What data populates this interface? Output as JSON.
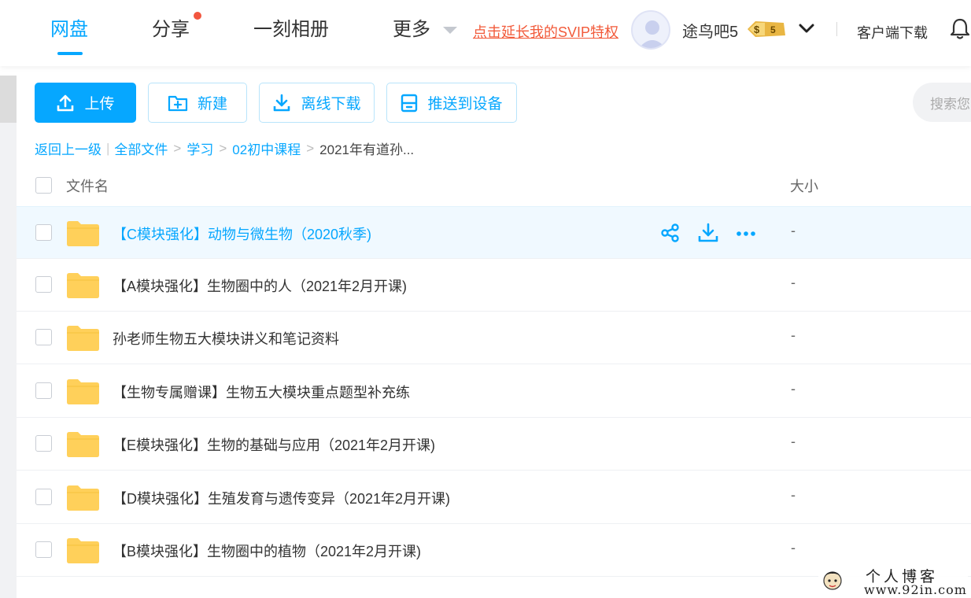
{
  "nav": {
    "tabs": [
      {
        "label": "网盘",
        "active": true
      },
      {
        "label": "分享",
        "has_dot": true
      },
      {
        "label": "一刻相册"
      },
      {
        "label": "更多"
      }
    ],
    "svip_link": "点击延长我的SVIP特权",
    "username": "途鸟吧5",
    "vip_level": "5",
    "client_download": "客户端下载"
  },
  "toolbar": {
    "upload": "上传",
    "new": "新建",
    "offline_download": "离线下载",
    "push_to_device": "推送到设备",
    "search_placeholder": "搜索您的文件"
  },
  "breadcrumb": {
    "back": "返回上一级",
    "items": [
      "全部文件",
      "学习",
      "02初中课程"
    ],
    "current": "2021年有道孙..."
  },
  "table": {
    "col_name": "文件名",
    "col_size": "大小",
    "rows": [
      {
        "name": "【C模块强化】动物与微生物（2020秋季)",
        "size": "-",
        "hover": true
      },
      {
        "name": "【A模块强化】生物圈中的人（2021年2月开课)",
        "size": "-"
      },
      {
        "name": "孙老师生物五大模块讲义和笔记资料",
        "size": "-"
      },
      {
        "name": "【生物专属赠课】生物五大模块重点题型补充练",
        "size": "-"
      },
      {
        "name": "【E模块强化】生物的基础与应用（2021年2月开课)",
        "size": "-"
      },
      {
        "name": "【D模块强化】生殖发育与遗传变异（2021年2月开课)",
        "size": "-"
      },
      {
        "name": "【B模块强化】生物圈中的植物（2021年2月开课)",
        "size": "-"
      }
    ]
  },
  "watermark": {
    "line1": "个人博客",
    "line2": "www.92in.com"
  },
  "colors": {
    "accent": "#06a7ff",
    "svip": "#f25a3a",
    "folder": "#ffd05a"
  }
}
